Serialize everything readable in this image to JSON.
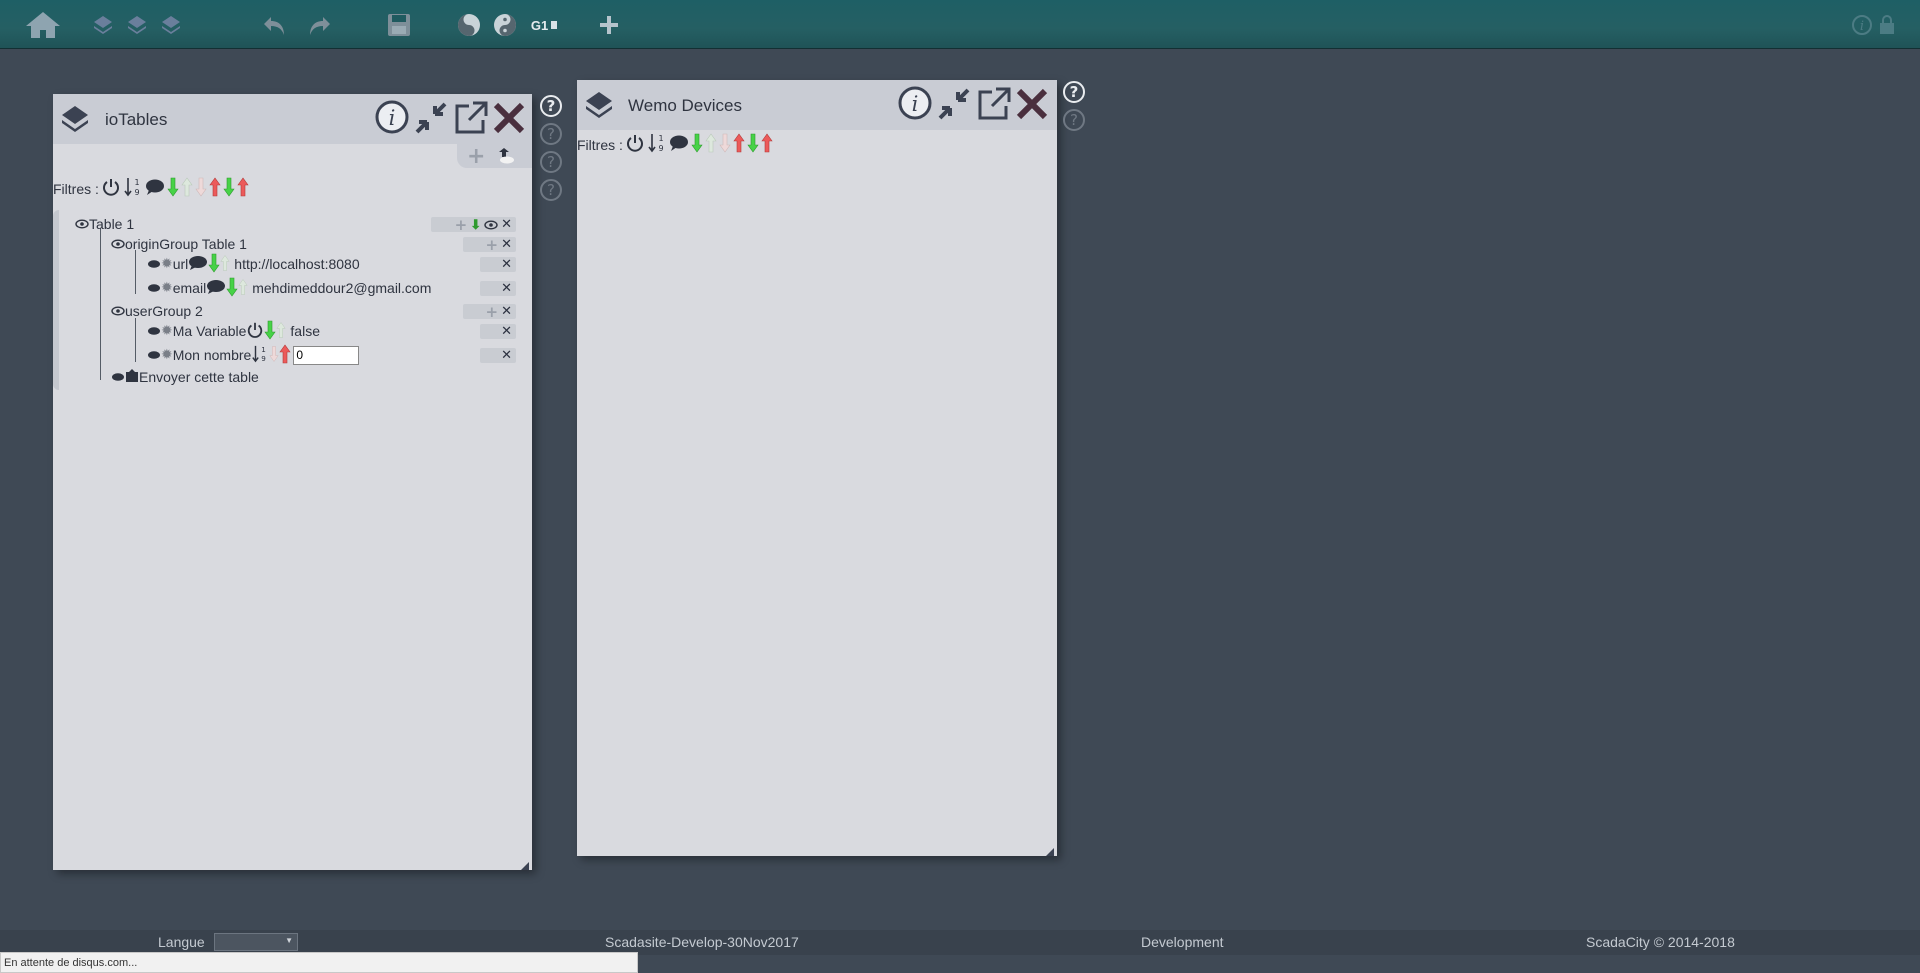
{
  "toolbar": {
    "group_label": "G1",
    "icons": [
      "home-icon",
      "layers-icon",
      "layers-icon",
      "layers-icon",
      "undo-icon",
      "redo-icon",
      "save-icon",
      "yin-yang-icon",
      "yin-yang-icon",
      "add-icon",
      "info-icon",
      "lock-icon"
    ]
  },
  "iotables": {
    "title": "ioTables",
    "filters_label": "Filtres :",
    "tree": {
      "table1": "Table 1",
      "origin_group": "originGroup Table 1",
      "url_label": "url",
      "url_value": "http://localhost:8080",
      "email_label": "email",
      "email_value": "mehdimeddour2@gmail.com",
      "user_group": "userGroup 2",
      "ma_variable_label": "Ma Variable",
      "ma_variable_value": "false",
      "mon_nombre_label": "Mon nombre",
      "mon_nombre_value": "0",
      "send_table": "Envoyer cette table"
    }
  },
  "wemo": {
    "title": "Wemo Devices",
    "filters_label": "Filtres :"
  },
  "footer": {
    "language_label": "Langue",
    "version": "Scadasite-Develop-30Nov2017",
    "environment": "Development",
    "copyright": "ScadaCity © 2014-2018"
  },
  "status": {
    "text": "En attente de disqus.com..."
  },
  "colors": {
    "topbar": "#1f5a5f",
    "background": "#3f4955",
    "panel": "#d9dadf",
    "panel_header": "#c9ccd4",
    "arrow_green": "#3ecf3e",
    "arrow_red": "#e84a4a"
  }
}
